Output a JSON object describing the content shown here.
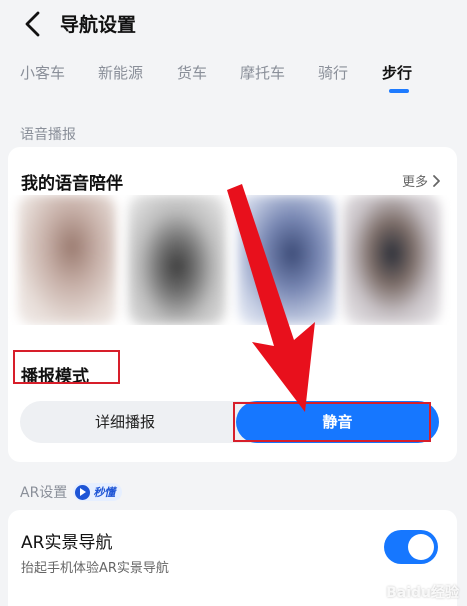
{
  "header": {
    "title": "导航设置"
  },
  "tabs": [
    {
      "label": "小客车"
    },
    {
      "label": "新能源"
    },
    {
      "label": "货车"
    },
    {
      "label": "摩托车"
    },
    {
      "label": "骑行"
    },
    {
      "label": "步行",
      "active": true
    }
  ],
  "voice_section": {
    "label": "语音播报",
    "companion_title": "我的语音陪伴",
    "more_label": "更多"
  },
  "broadcast_mode": {
    "title": "播报模式",
    "options": [
      "详细播报",
      "静音"
    ],
    "selected": "静音"
  },
  "ar_section": {
    "label": "AR设置",
    "badge_label": "秒懂",
    "item_title": "AR实景导航",
    "item_desc": "抬起手机体验AR实景导航",
    "toggle_on": true
  },
  "watermark": {
    "text": "Baidu经验"
  },
  "colors": {
    "accent": "#1677ff",
    "annotation_red": "#d71e2a",
    "arrow_red": "#e8101c"
  }
}
